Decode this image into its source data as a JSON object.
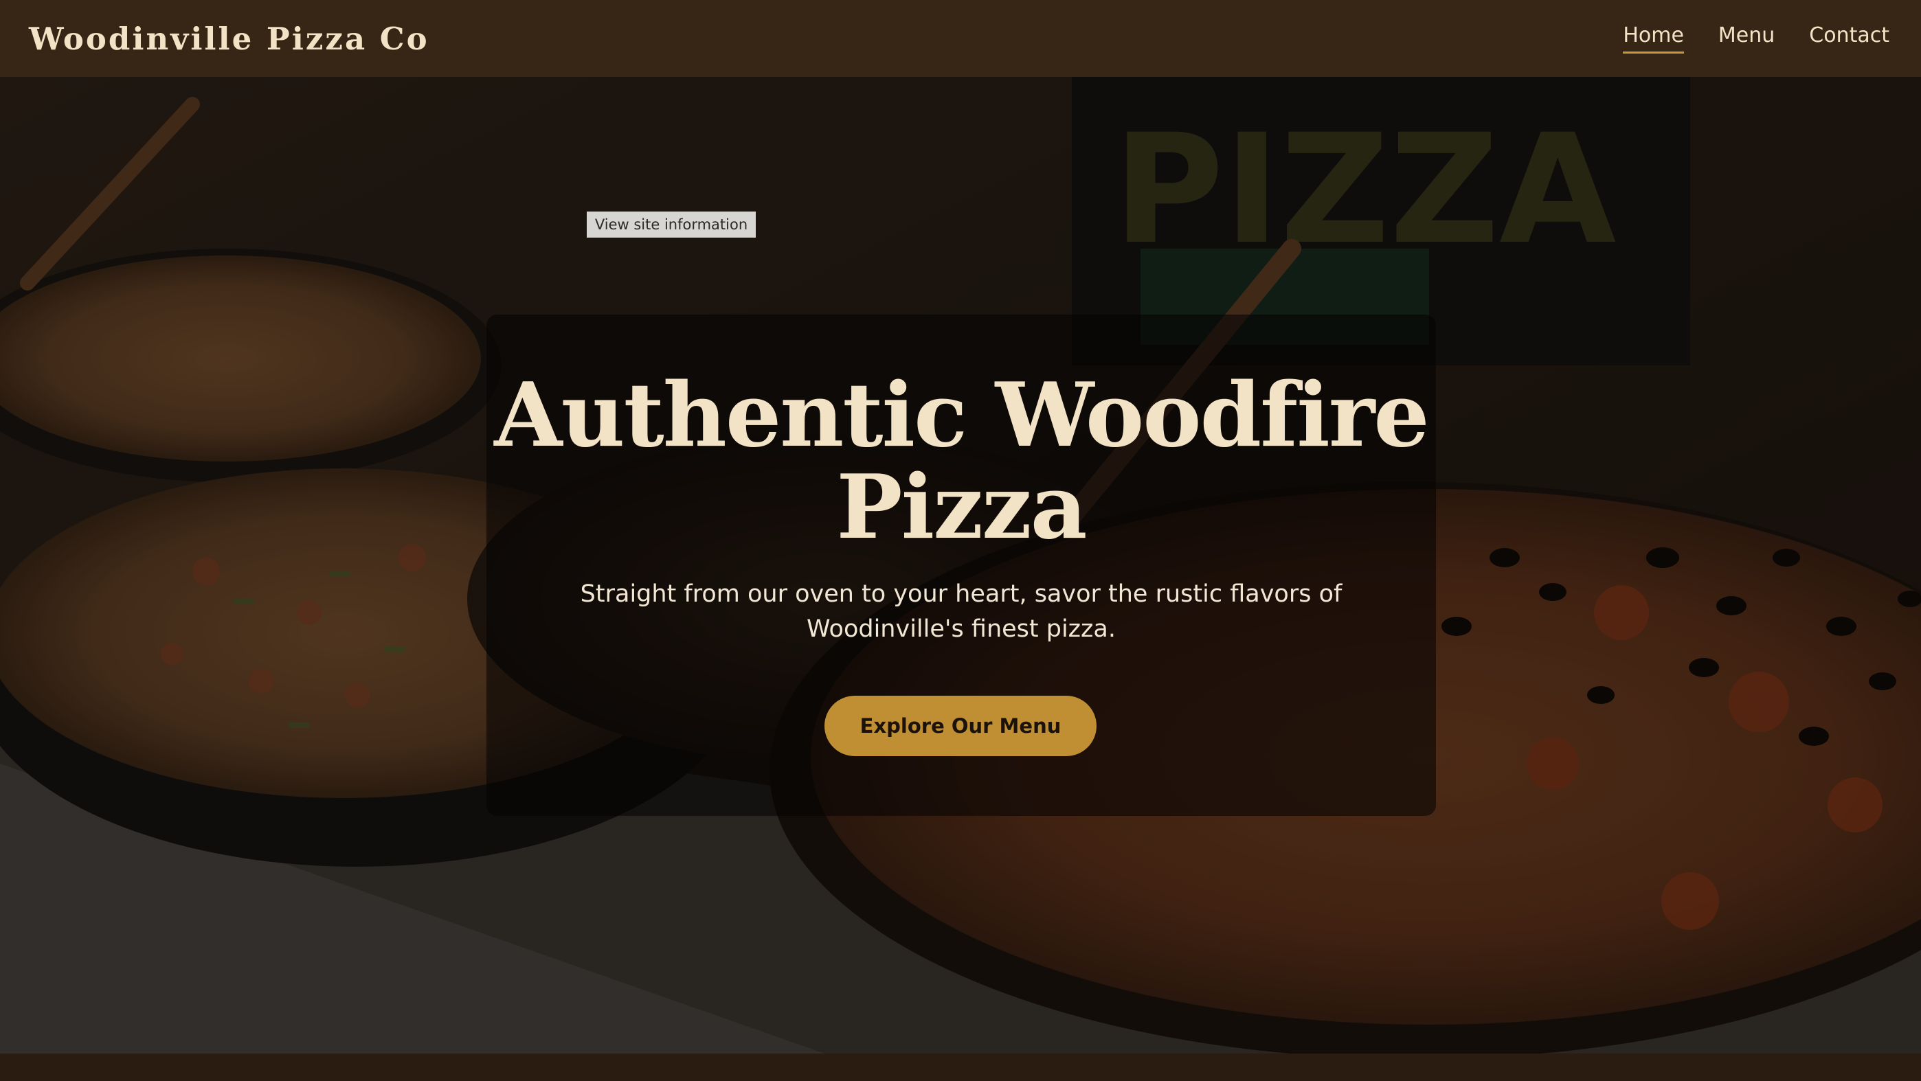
{
  "header": {
    "brand": "Woodinville Pizza Co",
    "nav": [
      {
        "label": "Home",
        "active": true
      },
      {
        "label": "Menu",
        "active": false
      },
      {
        "label": "Contact",
        "active": false
      }
    ]
  },
  "site_info_button": "View site information",
  "hero": {
    "title": "Authentic Woodfire Pizza",
    "subtitle": "Straight from our oven to your heart, savor the rustic flavors of Woodinville's finest pizza.",
    "cta_label": "Explore Our Menu",
    "background_image": "pizza-photo"
  },
  "colors": {
    "header_bg": "#372616",
    "cream_text": "#f3e3c6",
    "accent_gold": "#c18f33",
    "nav_underline": "#c99a3c"
  }
}
